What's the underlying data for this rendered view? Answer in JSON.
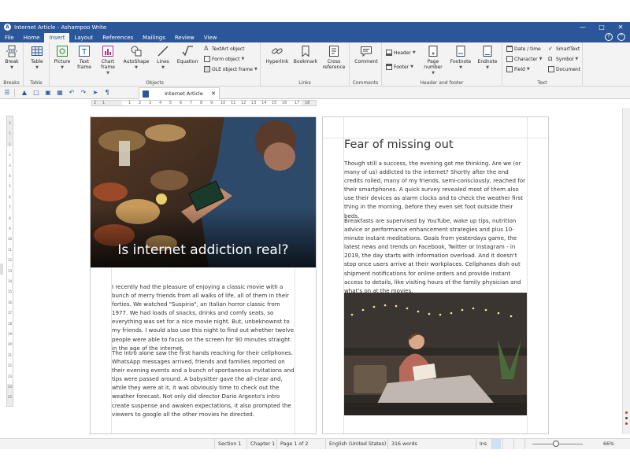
{
  "window": {
    "title": "Internet Article - Ashampoo Write",
    "app_icon": "ashampoo-write-icon",
    "controls": [
      "minimize-icon",
      "maximize-icon",
      "close-icon"
    ]
  },
  "menu": {
    "items": [
      "File",
      "Home",
      "Insert",
      "Layout",
      "References",
      "Mailings",
      "Review",
      "View"
    ],
    "active": "Insert"
  },
  "ribbon": {
    "groups": [
      {
        "label": "Breaks",
        "buttons": [
          {
            "label": "Break",
            "icon": "page-break-icon"
          }
        ]
      },
      {
        "label": "Table",
        "buttons": [
          {
            "label": "Table",
            "icon": "table-icon"
          }
        ]
      },
      {
        "label": "Objects",
        "buttons": [
          {
            "label": "Picture",
            "icon": "picture-icon"
          },
          {
            "label": "Text frame",
            "icon": "text-frame-icon"
          },
          {
            "label": "Chart frame",
            "icon": "chart-frame-icon"
          },
          {
            "label": "AutoShape",
            "icon": "autoshape-icon"
          },
          {
            "label": "Lines",
            "icon": "lines-icon"
          },
          {
            "label": "Equation",
            "icon": "equation-icon"
          }
        ],
        "small": [
          "TextArt object",
          "Form object",
          "OLE object frame"
        ]
      },
      {
        "label": "Links",
        "buttons": [
          {
            "label": "Hyperlink",
            "icon": "hyperlink-icon"
          },
          {
            "label": "Bookmark",
            "icon": "bookmark-icon"
          },
          {
            "label": "Cross reference",
            "icon": "cross-reference-icon"
          }
        ]
      },
      {
        "label": "Comments",
        "buttons": [
          {
            "label": "Comment",
            "icon": "comment-icon"
          }
        ]
      },
      {
        "label": "Header and footer",
        "buttons": [
          {
            "label": "Page number",
            "icon": "page-number-icon"
          },
          {
            "label": "Footnote",
            "icon": "footnote-icon"
          },
          {
            "label": "Endnote",
            "icon": "endnote-icon"
          }
        ],
        "small": [
          "Header",
          "Footer"
        ]
      },
      {
        "label": "Text",
        "small": [
          "Date / time",
          "Character",
          "Field",
          "SmartText",
          "Symbol",
          "Document"
        ]
      }
    ]
  },
  "document_tab": {
    "title": "Internet Article"
  },
  "ruler": {
    "numbers": [
      "2",
      "1",
      "1",
      "2",
      "3",
      "4",
      "5",
      "6",
      "7",
      "8",
      "9",
      "10",
      "11",
      "12",
      "13",
      "14",
      "15",
      "16",
      "17",
      "18"
    ]
  },
  "page1": {
    "hero_title": "Is internet addiction real?",
    "paragraphs": [
      "I recently had the pleasure of enjoying a classic movie with a bunch of merry friends from all walks of life, all of them in their forties. We watched \"Suspiria\", an Italian horror classic from 1977. We had loads of snacks, drinks and comfy seats, so everything was set for a nice movie night. But, unbeknownst to my friends. I would also use this night to find out whether twelve people were able to focus on the screen for 90 minutes straight in the age of the internet.",
      "The intro alone saw the first hands reaching for their cellphones. WhatsApp messages arrived, friends and families reported on their evening events and a bunch of spontaneous invitations and tips were passed around. A babysitter gave the all-clear and, while they were at it, it was obviously time to check out the weather forecast. Not only did director Dario Argento's intro create suspense and awaken expectations, it also prompted the viewers to google all the other movies he directed."
    ]
  },
  "page2": {
    "heading": "Fear of missing out",
    "paragraphs": [
      "Though still a success, the evening got me thinking. Are we (or many of us) addicted to the internet? Shortly after the end credits rolled, many of my friends, semi-consciously, reached for their smartphones. A quick survey revealed most of them also use their devices as alarm clocks and to check the weather first thing in the morning, before they even set foot outside their beds.",
      "Breakfasts are supervised by YouTube, wake up tips, nutrition advice or performance enhancement strategies and plus 10-minute instant meditations. Goals from yesterdays game, the latest news and trends on Facebook, Twitter or Instagram - in 2019, the day starts with information overload. And it doesn't stop once users arrive at their workplaces. Cellphones dish out shipment notifications for online orders and provide instant access to details, like visiting hours of the family physician and what's on at the movies."
    ]
  },
  "status": {
    "section": "Section 1",
    "chapter": "Chapter 1",
    "page": "Page 1 of 2",
    "language": "English (United States)",
    "words": "316 words",
    "mode": "Ins",
    "zoom": "66%",
    "zoom_level": 0.66
  },
  "colors": {
    "accent": "#2b579a",
    "ribbon_bg": "#f3f3f3"
  }
}
